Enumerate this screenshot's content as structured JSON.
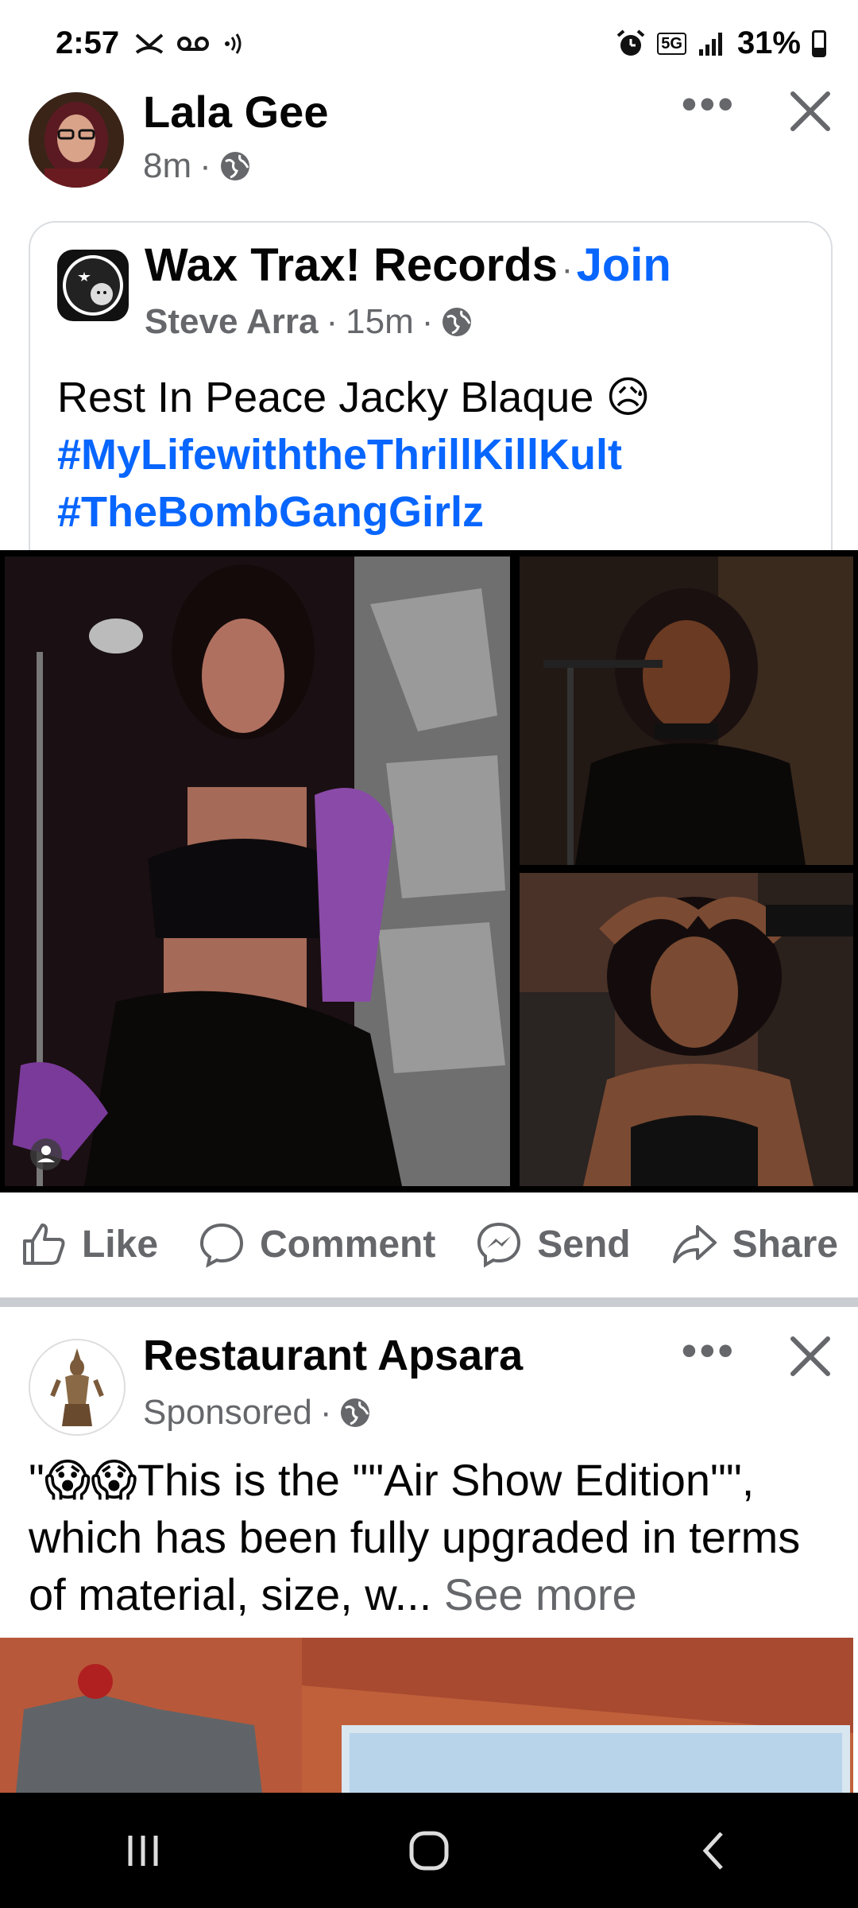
{
  "status_bar": {
    "time": "2:57",
    "left_icons": [
      "missed-call-icon",
      "voicemail-icon",
      "nfc-icon"
    ],
    "right_icons": [
      "alarm-icon",
      "5g-icon",
      "signal-icon"
    ],
    "network": "5G",
    "battery_percent_label": "31%",
    "battery_level": 0.31
  },
  "post": {
    "author": "Lala Gee",
    "time": "8m",
    "separator": "·",
    "audience_icon": "globe-icon",
    "shared": {
      "page_name": "Wax Trax! Records",
      "join_label": "Join",
      "author": "Steve Arra",
      "time": "15m",
      "text": "Rest In Peace Jacky Blaque",
      "emoji": "😥",
      "hashtags": [
        "#MyLifewiththeThrillKillKult",
        "#TheBombGangGirlz"
      ]
    },
    "actions": [
      {
        "label": "Like",
        "icon": "like-icon"
      },
      {
        "label": "Comment",
        "icon": "comment-icon"
      },
      {
        "label": "Send",
        "icon": "messenger-icon"
      },
      {
        "label": "Share",
        "icon": "share-icon"
      }
    ]
  },
  "ad": {
    "advertiser": "Restaurant Apsara",
    "sponsored_label": "Sponsored",
    "separator": "·",
    "text_prefix": "\"",
    "emojis": "😱😱",
    "text_body": "This is the \"\"Air Show Edition\"\", which has been fully upgraded in terms of material, size, w...",
    "see_more": "See more"
  },
  "colors": {
    "link_blue": "#0866ff",
    "secondary_text": "#65676b",
    "divider": "#c9ccd1"
  }
}
